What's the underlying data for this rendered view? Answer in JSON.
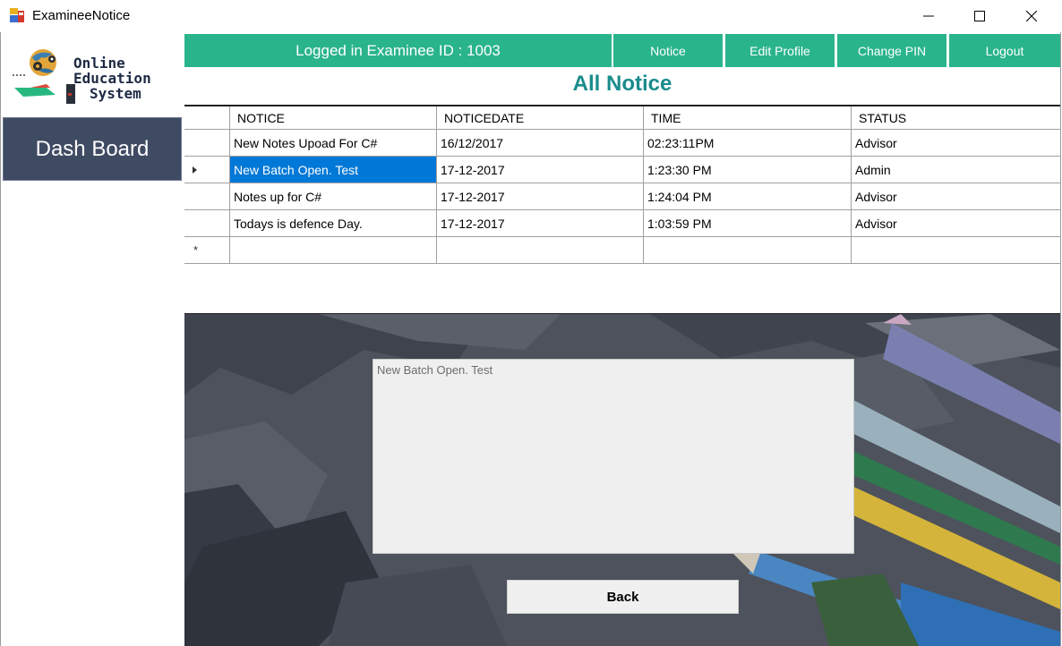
{
  "window": {
    "title": "ExamineeNotice"
  },
  "logo": {
    "line1": "Online",
    "line2": "Education",
    "line3": "System"
  },
  "sidebar": {
    "dashboard_label": "Dash Board"
  },
  "nav": {
    "logged_in_text": "Logged in Examinee ID : 1003",
    "notice_label": "Notice",
    "edit_profile_label": "Edit Profile",
    "change_pin_label": "Change PIN",
    "logout_label": "Logout"
  },
  "page": {
    "title": "All Notice"
  },
  "table": {
    "columns": [
      "NOTICE",
      "NOTICEDATE",
      "TIME",
      "STATUS"
    ],
    "rows": [
      {
        "notice": "New Notes Upoad For C#",
        "date": "16/12/2017",
        "time": "02:23:11PM",
        "status": "Advisor"
      },
      {
        "notice": "New Batch Open. Test",
        "date": "17-12-2017",
        "time": "1:23:30 PM",
        "status": "Admin"
      },
      {
        "notice": "Notes up for C#",
        "date": "17-12-2017",
        "time": "1:24:04 PM",
        "status": "Advisor"
      },
      {
        "notice": "Todays is defence Day.",
        "date": "17-12-2017",
        "time": "1:03:59 PM",
        "status": "Advisor"
      }
    ],
    "new_row_marker": "*"
  },
  "detail": {
    "text": "New Batch Open. Test"
  },
  "buttons": {
    "back_label": "Back"
  },
  "colors": {
    "nav_green": "#2ab48c",
    "title_teal": "#1a8c8c",
    "sidebar_dark": "#3f4a63",
    "selection_blue": "#0078d7"
  }
}
